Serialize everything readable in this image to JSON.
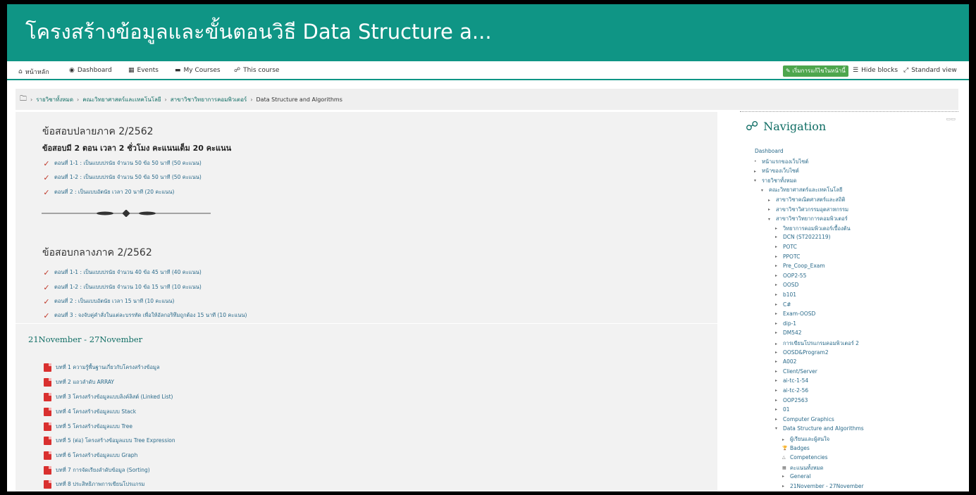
{
  "banner": {
    "title": "โครงสร้างข้อมูลและขั้นตอนวิธี Data Structure a..."
  },
  "navbar": {
    "home": "หน้าหลัก",
    "dashboard": "Dashboard",
    "events": "Events",
    "my_courses": "My Courses",
    "this_course": "This course",
    "edit_button": "เริ่มการแก้ไขในหน้านี้",
    "hide_blocks": "Hide blocks",
    "standard_view": "Standard view"
  },
  "breadcrumb": {
    "items": [
      "รายวิชาทั้งหมด",
      "คณะวิทยาศาสตร์และเทคโนโลยี",
      "สาขาวิชาวิทยาการคอมพิวเตอร์",
      "Data Structure and Algorithms"
    ]
  },
  "final_exam": {
    "title": "ข้อสอบปลายภาค 2/2562",
    "subtitle": "ข้อสอบมี 2 ตอน   เวลา 2 ชั่วโมง  คะแนนเต็ม 20 คะแนน",
    "items": [
      "ตอนที่ 1-1 : เป็นแบบปรนัย จำนวน 50 ข้อ 50 นาที (50 คะแนน)",
      "ตอนที่ 1-2 : เป็นแบบปรนัย จำนวน 50 ข้อ 50 นาที (50 คะแนน)",
      "ตอนที่ 2 : เป็นแบบอัตนัย เวลา 20 นาที (20 คะแนน)"
    ]
  },
  "midterm_exam": {
    "title": "ข้อสอบกลางภาค 2/2562",
    "items": [
      "ตอนที่ 1-1 : เป็นแบบปรนัย จำนวน 40 ข้อ 45 นาที (40 คะแนน)",
      "ตอนที่ 1-2 : เป็นแบบปรนัย จำนวน 10 ข้อ 15 นาที (10 คะแนน)",
      "ตอนที่ 2 : เป็นแบบอัตนัย เวลา 15 นาที (10 คะแนน)",
      "ตอนที่ 3 : จงจับคู่คำสั่งในแต่ละบรรทัด เพื่อให้อัลกอริทึมถูกต้อง 15 นาที (10 คะแนน)"
    ]
  },
  "week": {
    "title": "21November - 27November",
    "files": [
      "บทที่ 1 ความรู้พื้นฐานเกี่ยวกับโครงสร้างข้อมูล",
      "บทที่ 2 แถวลำดับ ARRAY",
      "บทที่ 3 โครงสร้างข้อมูลแบบลิงค์ลิสต์ (Linked List)",
      "บทที่ 4 โครงสร้างข้อมูลแบบ Stack",
      "บทที่ 5 โครงสร้างข้อมูลแบบ Tree",
      "บทที่ 5 (ต่อ) โครงสร้างข้อมูลแบบ Tree Expression",
      "บทที่ 6 โครงสร้างข้อมูลแบบ Graph",
      "บทที่ 7 การจัดเรียงลำดับข้อมูล (Sorting)",
      "บทที่ 8 ประสิทธิภาพการเขียนโปรแกรม"
    ]
  },
  "navigation": {
    "title": "Navigation",
    "items": [
      {
        "label": "Dashboard",
        "indent": 0,
        "marker": ""
      },
      {
        "label": "หน้าแรกของเว็บไซต์",
        "indent": 1,
        "marker": "•"
      },
      {
        "label": "หน้าของเว็บไซต์",
        "indent": 1,
        "marker": "▸"
      },
      {
        "label": "รายวิชาทั้งหมด",
        "indent": 1,
        "marker": "▾"
      },
      {
        "label": "คณะวิทยาศาสตร์และเทคโนโลยี",
        "indent": 2,
        "marker": "▾"
      },
      {
        "label": "สาขาวิชาคณิตศาสตร์และสถิติ",
        "indent": 3,
        "marker": "▸"
      },
      {
        "label": "สาขาวิชาวิศวกรรมอุตสาหกรรม",
        "indent": 3,
        "marker": "▸"
      },
      {
        "label": "สาขาวิชาวิทยาการคอมพิวเตอร์",
        "indent": 3,
        "marker": "▾"
      },
      {
        "label": "วิทยาการคอมพิวเตอร์เบื้องต้น",
        "indent": 4,
        "marker": "▸"
      },
      {
        "label": "DCN (ST2022119)",
        "indent": 4,
        "marker": "▸"
      },
      {
        "label": "POTC",
        "indent": 4,
        "marker": "▸"
      },
      {
        "label": "PPOTC",
        "indent": 4,
        "marker": "▸"
      },
      {
        "label": "Pre_Coop_Exam",
        "indent": 4,
        "marker": "▸"
      },
      {
        "label": "OOP2-55",
        "indent": 4,
        "marker": "▸"
      },
      {
        "label": "OOSD",
        "indent": 4,
        "marker": "▸"
      },
      {
        "label": "b101",
        "indent": 4,
        "marker": "▸"
      },
      {
        "label": "C#",
        "indent": 4,
        "marker": "▸"
      },
      {
        "label": "Exam-OOSD",
        "indent": 4,
        "marker": "▸"
      },
      {
        "label": "dip-1",
        "indent": 4,
        "marker": "▸"
      },
      {
        "label": "DM542",
        "indent": 4,
        "marker": "▸"
      },
      {
        "label": "การเขียนโปรแกรมคอมพิวเตอร์ 2",
        "indent": 4,
        "marker": "▸"
      },
      {
        "label": "OOSD&Program2",
        "indent": 4,
        "marker": "▸"
      },
      {
        "label": "A002",
        "indent": 4,
        "marker": "▸"
      },
      {
        "label": "Client/Server",
        "indent": 4,
        "marker": "▸"
      },
      {
        "label": "ai-tc-1-54",
        "indent": 4,
        "marker": "▸"
      },
      {
        "label": "ai-tc-2-56",
        "indent": 4,
        "marker": "▸"
      },
      {
        "label": "OOP2563",
        "indent": 4,
        "marker": "▸"
      },
      {
        "label": "01",
        "indent": 4,
        "marker": "▸"
      },
      {
        "label": "Computer Graphics",
        "indent": 4,
        "marker": "▸"
      },
      {
        "label": "Data Structure and Algorithms",
        "indent": 4,
        "marker": "▾"
      },
      {
        "label": "ผู้เรียนและผู้สนใจ",
        "indent": 5,
        "marker": "▸"
      },
      {
        "label": "Badges",
        "indent": 5,
        "marker": "🏆"
      },
      {
        "label": "Competencies",
        "indent": 5,
        "marker": "△"
      },
      {
        "label": "คะแนนทั้งหมด",
        "indent": 5,
        "marker": "▦"
      },
      {
        "label": "General",
        "indent": 5,
        "marker": "▸"
      },
      {
        "label": "21November - 27November",
        "indent": 5,
        "marker": "▸"
      }
    ]
  }
}
